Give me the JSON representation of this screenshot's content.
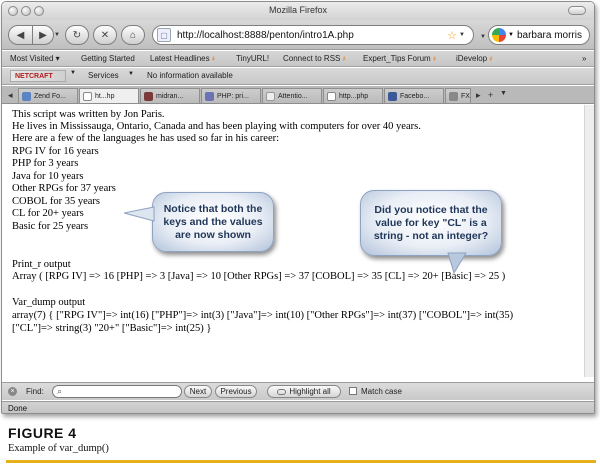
{
  "window": {
    "title": "Mozilla Firefox"
  },
  "navigation": {
    "url": "http://localhost:8888/penton/intro1A.php",
    "search_value": "barbara morris"
  },
  "bookmarks": [
    {
      "label": "Most Visited",
      "suffix": "▾"
    },
    {
      "label": "Getting Started",
      "suffix": ""
    },
    {
      "label": "Latest Headlines",
      "suffix": "҂"
    },
    {
      "label": "TinyURL!",
      "suffix": ""
    },
    {
      "label": "Connect to RSS",
      "suffix": "҂"
    },
    {
      "label": "Expert_Tips Forum",
      "suffix": "҂"
    },
    {
      "label": "iDevelop",
      "suffix": "҂"
    },
    {
      "label": "»",
      "suffix": ""
    }
  ],
  "toolbar2": {
    "netcraft": "NETCRAFT",
    "services": "Services",
    "info": "No information available"
  },
  "tabs": [
    {
      "label": "Zend Fo...",
      "color": "#5b84c4"
    },
    {
      "label": "ht...hp",
      "color": "#ffffff"
    },
    {
      "label": "midran...",
      "color": "#7a3a3a"
    },
    {
      "label": "PHP: pri...",
      "color": "#6b73b4"
    },
    {
      "label": "Attentio...",
      "color": "#eeeeee"
    },
    {
      "label": "http...php",
      "color": "#ffffff"
    },
    {
      "label": "Facebo...",
      "color": "#3b5998"
    },
    {
      "label": "FX",
      "color": "#888888"
    }
  ],
  "content": {
    "lines": [
      "This script was written by Jon Paris.",
      "He lives in Mississauga, Ontario, Canada and has been playing with computers for over 40 years.",
      "Here are a few of the languages he has used so far in his career:",
      "RPG IV for 16 years",
      "PHP for 3 years",
      "Java for 10 years",
      "Other RPGs for 37 years",
      "COBOL for 35 years",
      "CL for 20+ years",
      "Basic for 25 years",
      "Print_r output",
      "Array ( [RPG IV] => 16 [PHP] => 3 [Java] => 10 [Other RPGs] => 37 [COBOL] => 35 [CL] => 20+ [Basic] => 25 )",
      "Var_dump output",
      "array(7) { [\"RPG IV\"]=> int(16) [\"PHP\"]=> int(3) [\"Java\"]=> int(10) [\"Other RPGs\"]=> int(37) [\"COBOL\"]=> int(35)",
      "[\"CL\"]=> string(3) \"20+\" [\"Basic\"]=> int(25) }"
    ]
  },
  "callouts": {
    "left": "Notice that both the keys and the values are now shown",
    "right": "Did you notice that the value for key \"CL\" is a string - not an integer?"
  },
  "findbar": {
    "label": "Find:",
    "next": "Next",
    "previous": "Previous",
    "highlight": "Highlight all",
    "match_case": "Match case"
  },
  "status": "Done",
  "figure": {
    "label": "FIGURE 4",
    "caption": "Example of var_dump()"
  }
}
